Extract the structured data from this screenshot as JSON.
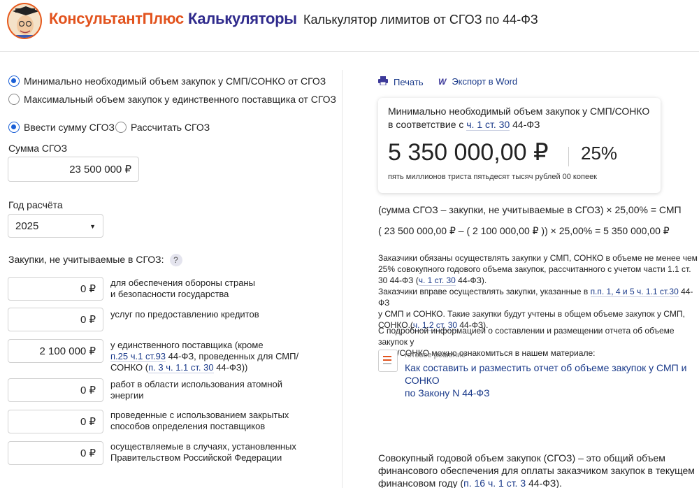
{
  "header": {
    "brand_part1": "КонсультантПлюс",
    "brand_part2": "Калькуляторы",
    "title": "Калькулятор лимитов от СГОЗ по 44-ФЗ"
  },
  "mode": {
    "option_min": "Минимально необходимый объем закупок у СМП/СОНКО от СГОЗ",
    "option_max": "Максимальный объем закупок у единственного поставщика от СГОЗ"
  },
  "input_type": {
    "option_enter": "Ввести сумму СГОЗ",
    "option_calc": "Рассчитать СГОЗ"
  },
  "sgoz": {
    "label": "Сумма СГОЗ",
    "value": "23 500 000 ₽"
  },
  "year": {
    "label": "Год расчёта",
    "value": "2025"
  },
  "excluded": {
    "label": "Закупки, не учитываемые в СГОЗ:",
    "help": "?",
    "rows": [
      {
        "value": "0 ₽",
        "line1": "для обеспечения обороны страны",
        "line2": "и безопасности государства"
      },
      {
        "value": "0 ₽",
        "line1": "услуг по предоставлению кредитов"
      },
      {
        "value": "2 100 000 ₽",
        "line1": "у единственного поставщика (кроме",
        "link1": "п.25 ч.1 ст.93",
        "text2": " 44-ФЗ, проведенных для СМП/",
        "text3a": "СОНКО (",
        "link2": "п. 3 ч. 1.1 ст. 30",
        "text3b": " 44-ФЗ))"
      },
      {
        "value": "0 ₽",
        "line1": "работ в области использования атомной",
        "line2": "энергии"
      },
      {
        "value": "0 ₽",
        "line1": "проведенные с использованием закрытых",
        "line2": "способов определения поставщиков"
      },
      {
        "value": "0 ₽",
        "line1": "осуществляемые в случаях, установленных",
        "line2": "Правительством Российской Федерации"
      }
    ]
  },
  "tools": {
    "print": "Печать",
    "export": "Экспорт в Word"
  },
  "result": {
    "title_line1": "Минимально необходимый объем закупок у СМП/СОНКО",
    "title_line2a": "в соответствие с ",
    "title_link": "ч. 1 ст. 30",
    "title_line2b": " 44-ФЗ",
    "amount": "5 350 000,00 ₽",
    "percent": "25%",
    "words": "пять миллионов триста пятьдесят тысяч рублей 00 копеек"
  },
  "formula": {
    "line1": "(сумма СГОЗ – закупки, не учитываемые в СГОЗ) × 25,00% = СМП",
    "line2": "( 23 500 000,00 ₽ – ( 2 100 000,00 ₽ )) × 25,00% = 5 350 000,00 ₽"
  },
  "notes": {
    "p1_line1": "Заказчики обязаны осуществлять закупки у СМП, СОНКО в объеме не менее чем",
    "p1_line2": "25% совокупного годового объема закупок, рассчитанного с учетом части 1.1 ст.",
    "p1_line3a": "30 44-ФЗ (",
    "p1_link": "ч. 1 ст. 30",
    "p1_line3b": " 44-ФЗ).",
    "p2_line1a": "Заказчики вправе осуществлять закупки, указанные в ",
    "p2_link1": "п.п. 1, 4 и 5 ч. 1.1 ст.30",
    "p2_line1b": " 44-ФЗ",
    "p2_line2": "у СМП и СОНКО. Такие закупки будут учтены в общем объеме закупок у СМП,",
    "p2_line3a": "СОНКО.(",
    "p2_link2": "ч. 1.2 ст. 30",
    "p2_line3b": " 44-ФЗ).",
    "p3_line1": "С подробной информацией о составлении и размещении отчета об объеме закупок у",
    "p3_line2": "СМП/СОНКО можно ознакомиться в нашем материале:"
  },
  "ready_solution": {
    "kind": "готовое решение",
    "link_line1": "Как составить и разместить отчет об объеме закупок у СМП и СОНКО",
    "link_line2": "по Закону N 44-ФЗ"
  },
  "definition": {
    "line1": "Совокупный годовой объем закупок (СГОЗ) – это общий объем",
    "line2": "финансового обеспечения для оплаты заказчиком закупок в текущем",
    "line3a": "финансовом году (",
    "link": "п. 16 ч. 1 ст. 3",
    "line3b": " 44-ФЗ)."
  }
}
